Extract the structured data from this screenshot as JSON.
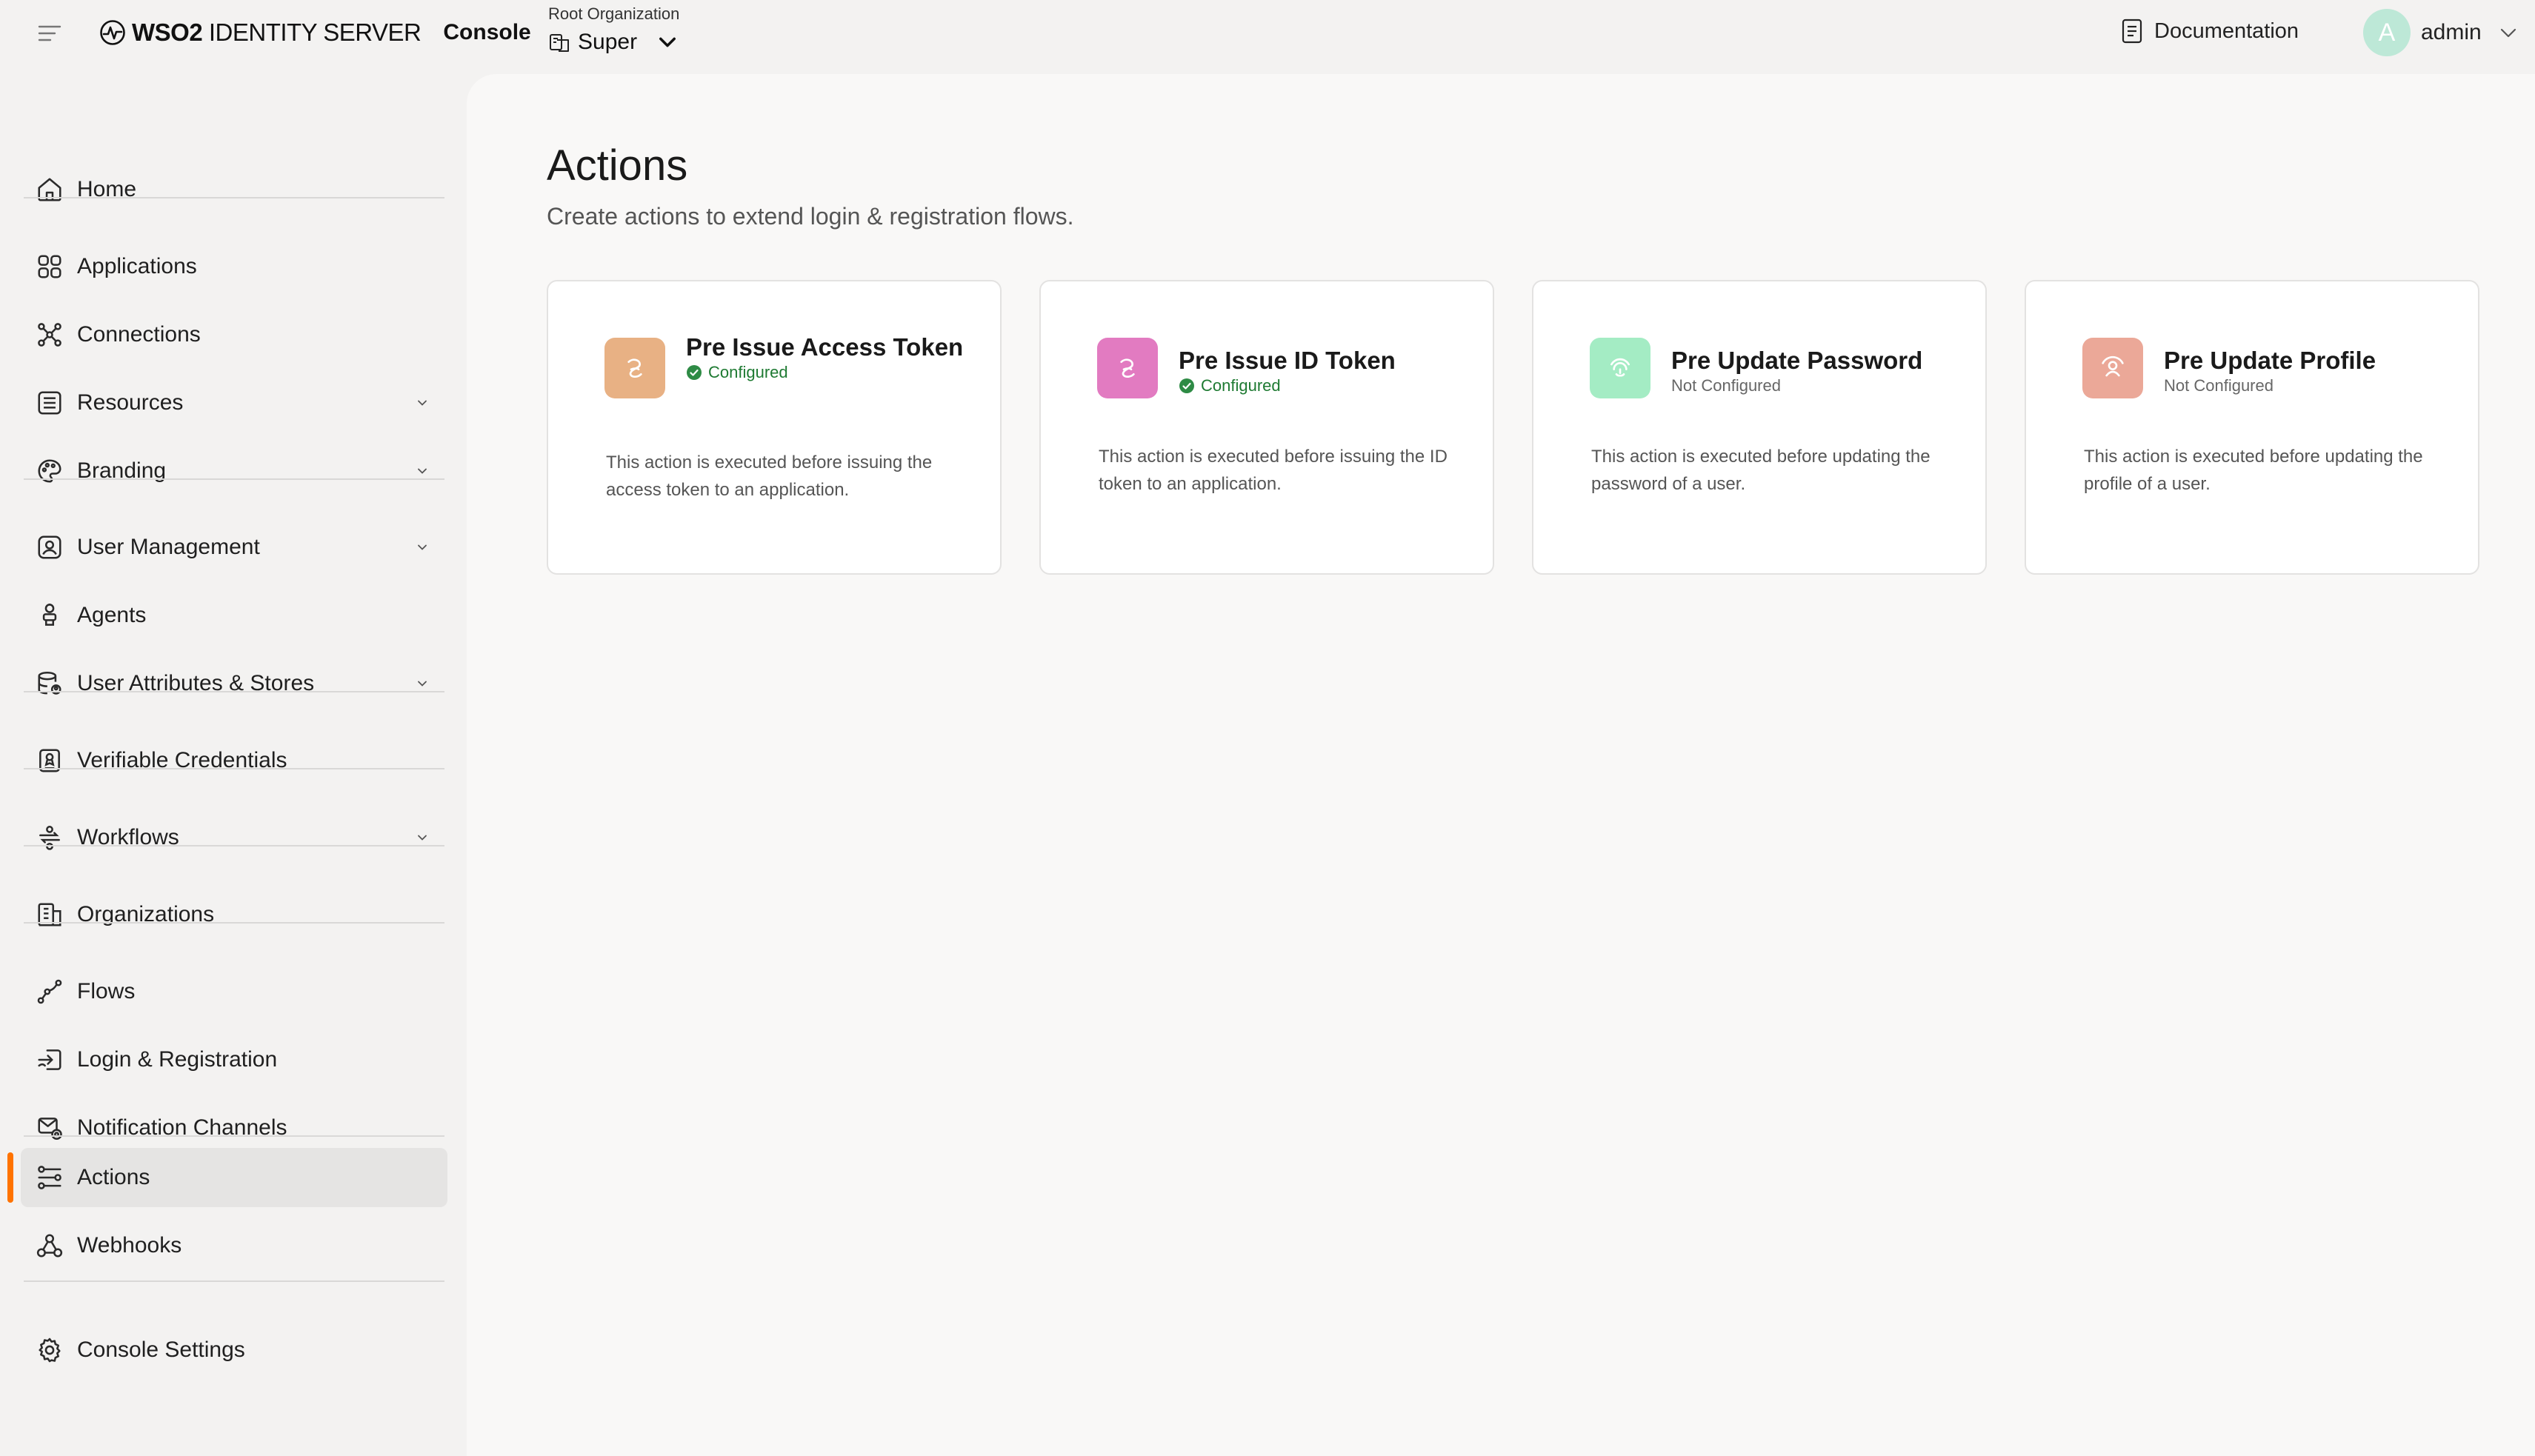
{
  "colors": {
    "accent": "#ff7300",
    "configured": "#1e7a32",
    "tile_pre_issue_access_token": "#e8b184",
    "tile_pre_issue_id_token": "#e27bc1",
    "tile_pre_update_password": "#a4ecc4",
    "tile_pre_update_profile": "#eba898"
  },
  "header": {
    "product_bold": "WSO2",
    "product_rest": " IDENTITY SERVER",
    "console": "Console",
    "org_label": "Root Organization",
    "org_name": "Super",
    "documentation": "Documentation",
    "avatar_initial": "A",
    "username": "admin"
  },
  "sidebar": {
    "items": [
      {
        "label": "Home",
        "icon": "home-icon"
      },
      {
        "label": "Applications",
        "icon": "applications-icon"
      },
      {
        "label": "Connections",
        "icon": "connections-icon"
      },
      {
        "label": "Resources",
        "icon": "resources-icon"
      },
      {
        "label": "Branding",
        "icon": "palette-icon"
      },
      {
        "label": "User Management",
        "icon": "user-management-icon"
      },
      {
        "label": "Agents",
        "icon": "agent-icon"
      },
      {
        "label": "User Attributes & Stores",
        "icon": "database-icon"
      },
      {
        "label": "Verifiable Credentials",
        "icon": "credential-icon"
      },
      {
        "label": "Workflows",
        "icon": "workflow-icon"
      },
      {
        "label": "Organizations",
        "icon": "building-icon"
      },
      {
        "label": "Flows",
        "icon": "flow-icon"
      },
      {
        "label": "Login & Registration",
        "icon": "login-icon"
      },
      {
        "label": "Notification Channels",
        "icon": "notification-icon"
      },
      {
        "label": "Actions",
        "icon": "actions-icon"
      },
      {
        "label": "Webhooks",
        "icon": "webhook-icon"
      },
      {
        "label": "Console Settings",
        "icon": "gear-icon"
      }
    ],
    "active": "Actions"
  },
  "main": {
    "title": "Actions",
    "subtitle": "Create actions to extend login & registration flows.",
    "cards": [
      {
        "title": "Pre Issue Access Token",
        "status": "Configured",
        "description": "This action is executed before issuing the access token to an application."
      },
      {
        "title": "Pre Issue ID Token",
        "status": "Configured",
        "description": "This action is executed before issuing the ID token to an application."
      },
      {
        "title": "Pre Update Password",
        "status": "Not Configured",
        "description": "This action is executed before updating the password of a user."
      },
      {
        "title": "Pre Update Profile",
        "status": "Not Configured",
        "description": "This action is executed before updating the profile of a user."
      }
    ]
  }
}
